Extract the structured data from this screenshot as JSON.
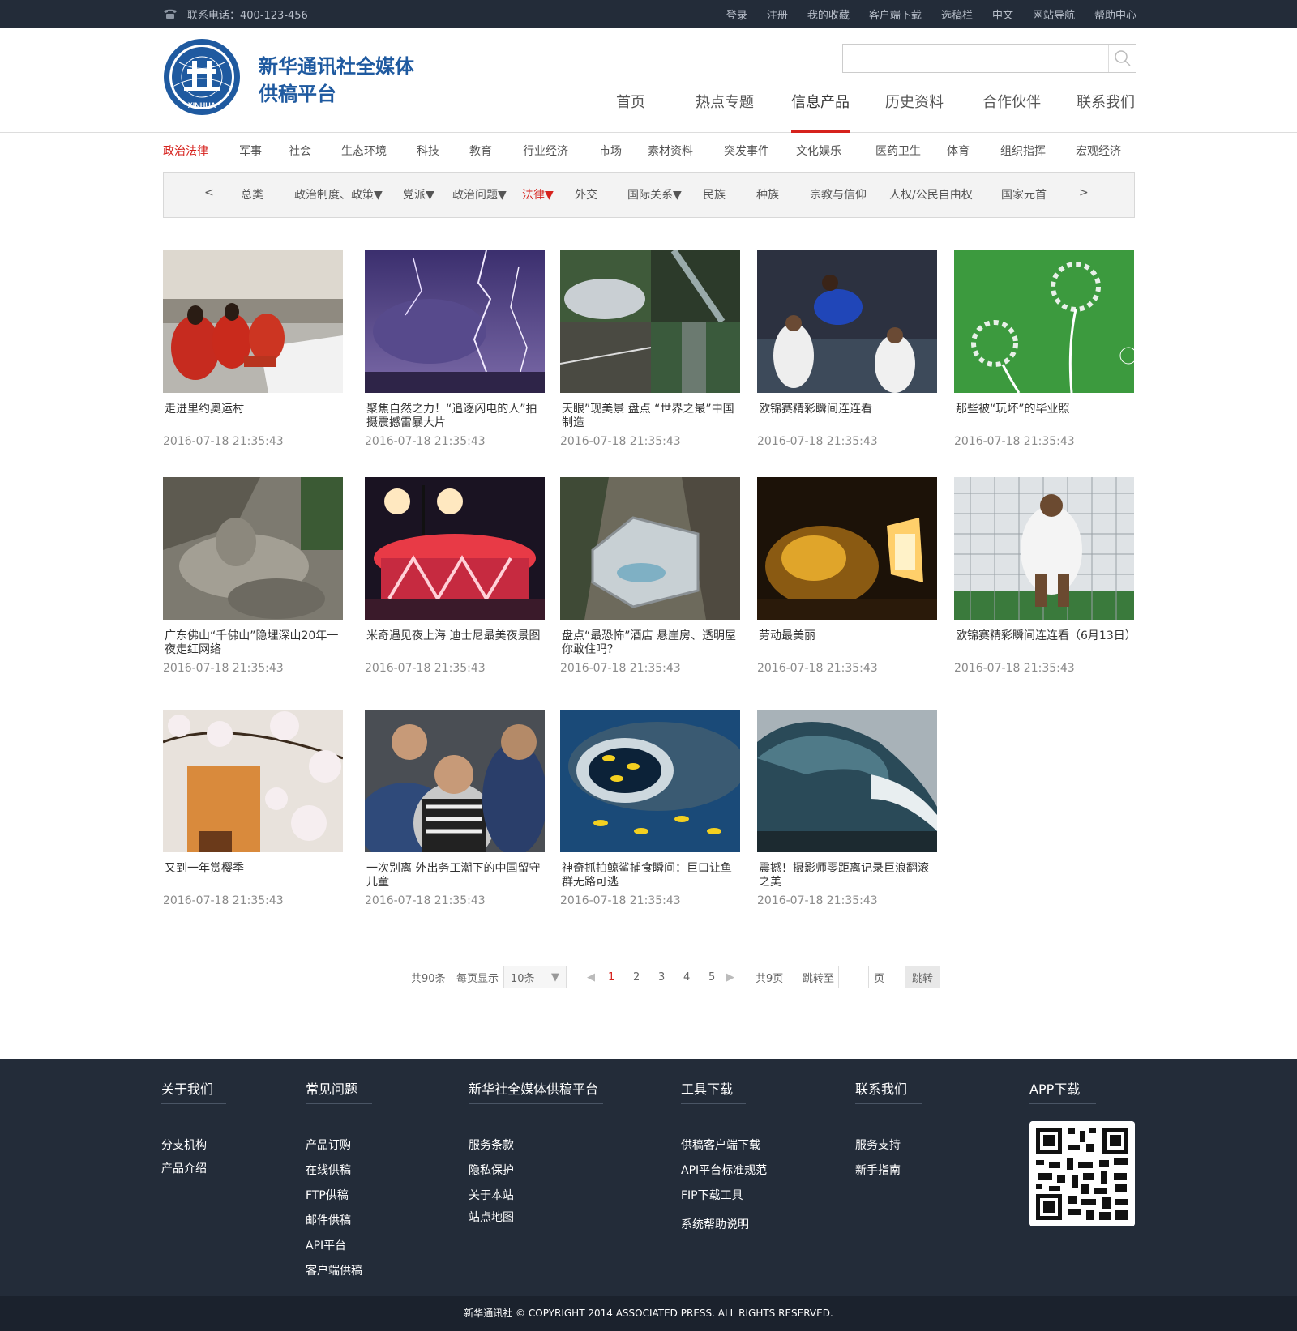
{
  "topbar": {
    "phone": "联系电话：400-123-456",
    "links": [
      "登录",
      "注册",
      "我的收藏",
      "客户端下载",
      "选稿栏",
      "中文",
      "网站导航",
      "帮助中心"
    ]
  },
  "header": {
    "brand_line1": "新华通讯社全媒体",
    "brand_line2": "供稿平台",
    "logo_text": "XINHUA",
    "search_placeholder": "",
    "nav": [
      "首页",
      "热点专题",
      "信息产品",
      "历史资料",
      "合作伙伴",
      "联系我们"
    ],
    "nav_active": "信息产品"
  },
  "categories": [
    "政治法律",
    "军事",
    "社会",
    "生态环境",
    "科技",
    "教育",
    "行业经济",
    "市场",
    "素材资料",
    "突发事件",
    "文化娱乐",
    "医药卫生",
    "体育",
    "组织指挥",
    "宏观经济"
  ],
  "category_active": "政治法律",
  "subcategories": {
    "prev": "<",
    "next": ">",
    "items": [
      "总类",
      "政治制度、政策▼",
      "党派▼",
      "政治问题▼",
      "法律▼",
      "外交",
      "国际关系▼",
      "民族",
      "种族",
      "宗教与信仰",
      "人权/公民自由权",
      "国家元首"
    ],
    "active": "法律▼"
  },
  "cards": [
    {
      "title": "走进里约奥运村",
      "date": "2016-07-18 21:35:43"
    },
    {
      "title": "聚焦自然之力！“追逐闪电的人”拍摄震撼雷暴大片",
      "date": "2016-07-18 21:35:43"
    },
    {
      "title": "天眼”现美景 盘点 “世界之最”中国制造",
      "date": "2016-07-18 21:35:43"
    },
    {
      "title": "欧锦赛精彩瞬间连连看",
      "date": "2016-07-18 21:35:43"
    },
    {
      "title": "那些被“玩坏”的毕业照",
      "date": "2016-07-18 21:35:43"
    },
    {
      "title": "广东佛山“千佛山”隐埋深山20年一夜走红网络",
      "date": "2016-07-18 21:35:43"
    },
    {
      "title": "米奇遇见夜上海 迪士尼最美夜景图",
      "date": "2016-07-18 21:35:43"
    },
    {
      "title": "盘点“最恐怖”酒店 悬崖房、透明屋你敢住吗？",
      "date": "2016-07-18 21:35:43"
    },
    {
      "title": "劳动最美丽",
      "date": "2016-07-18 21:35:43"
    },
    {
      "title": "欧锦赛精彩瞬间连连看（6月13日）",
      "date": "2016-07-18 21:35:43"
    },
    {
      "title": "又到一年赏樱季",
      "date": "2016-07-18 21:35:43"
    },
    {
      "title": "一次别离 外出务工潮下的中国留守儿童",
      "date": "2016-07-18 21:35:43"
    },
    {
      "title": "神奇抓拍鲸鲨捕食瞬间：巨口让鱼群无路可逃",
      "date": "2016-07-18 21:35:43"
    },
    {
      "title": "震撼！摄影师零距离记录巨浪翻滚之美",
      "date": "2016-07-18 21:35:43"
    }
  ],
  "pager": {
    "total": "共90条",
    "per_page_label": "每页显示",
    "per_page_value": "10条",
    "pages": [
      "1",
      "2",
      "3",
      "4",
      "5"
    ],
    "current": "1",
    "total_pages": "共9页",
    "jump_label": "跳转至",
    "page_unit": "页",
    "jump_button": "跳转"
  },
  "footer": {
    "columns": [
      {
        "title": "关于我们",
        "links": [
          "分支机构",
          "产品介绍"
        ]
      },
      {
        "title": "常见问题",
        "links": [
          "产品订购",
          "在线供稿",
          "FTP供稿",
          "邮件供稿",
          "API平台",
          "客户端供稿"
        ]
      },
      {
        "title": "新华社全媒体供稿平台",
        "links": [
          "服务条款",
          "隐私保护",
          "关于本站",
          "站点地图"
        ]
      },
      {
        "title": "工具下载",
        "links": [
          "供稿客户端下载",
          "API平台标准规范",
          "FIP下载工具",
          "系统帮助说明"
        ]
      },
      {
        "title": "联系我们",
        "links": [
          "服务支持",
          "新手指南"
        ]
      },
      {
        "title": "APP下载",
        "links": []
      }
    ],
    "copyright": "新华通讯社 © COPYRIGHT 2014 ASSOCIATED PRESS. ALL RIGHTS RESERVED."
  },
  "colors": {
    "accent": "#d6221d",
    "topbar": "#232c39",
    "footer": "#232c39",
    "brand": "#1f5aa0"
  },
  "icons": {
    "phone": "phone-icon",
    "search": "search-icon",
    "logo": "xinhua-logo"
  }
}
